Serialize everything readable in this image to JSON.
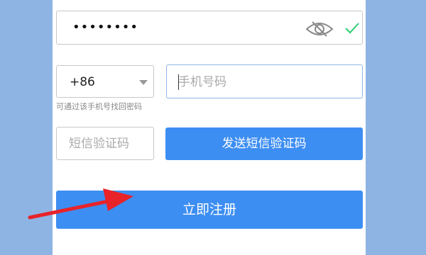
{
  "password": {
    "value": "••••••••",
    "visibility_icon": "eye-slash-icon",
    "valid_icon": "check-icon",
    "valid_color": "#2ecc71"
  },
  "country": {
    "code": "+86",
    "dropdown_icon": "caret-down-icon"
  },
  "phone": {
    "placeholder": "手机号码"
  },
  "hint": "可通过该手机号找回密码",
  "sms": {
    "placeholder": "短信验证码",
    "send_label": "发送短信验证码"
  },
  "register": {
    "label": "立即注册"
  },
  "colors": {
    "background": "#8eb4e3",
    "button": "#3d8ef2",
    "annotation_arrow": "#e8232a"
  }
}
